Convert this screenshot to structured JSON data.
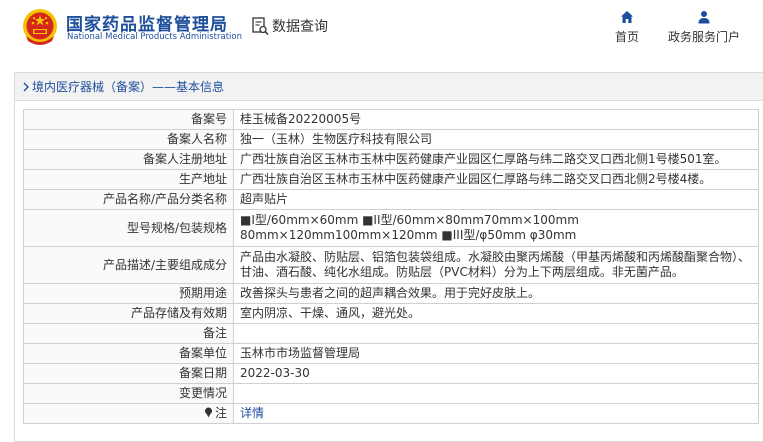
{
  "header": {
    "brand_cn": "国家药品监督管理局",
    "brand_en": "National Medical Products Administration",
    "query_label": "数据查询",
    "nav": [
      {
        "label": "首页",
        "icon": "home-icon"
      },
      {
        "label": "政务服务门户",
        "icon": "user-icon"
      }
    ]
  },
  "breadcrumb": "境内医疗器械（备案）——基本信息",
  "colors": {
    "brand_blue": "#1e4f9c",
    "emblem_red": "#d7261c",
    "emblem_gold": "#f2c300"
  },
  "rows": [
    {
      "label": "备案号",
      "value": "桂玉械备20220005号"
    },
    {
      "label": "备案人名称",
      "value": "独一（玉林）生物医疗科技有限公司"
    },
    {
      "label": "备案人注册地址",
      "value": "广西壮族自治区玉林市玉林中医药健康产业园区仁厚路与纬二路交叉口西北侧1号楼501室。"
    },
    {
      "label": "生产地址",
      "value": "广西壮族自治区玉林市玉林中医药健康产业园区仁厚路与纬二路交叉口西北侧2号楼4楼。"
    },
    {
      "label": "产品名称/产品分类名称",
      "value": "超声贴片"
    },
    {
      "label": "型号规格/包装规格",
      "value": "■I型/60mm×60mm ■II型/60mm×80mm70mm×100mm 80mm×120mm100mm×120mm ■III型/φ50mm φ30mm"
    },
    {
      "label": "产品描述/主要组成成分",
      "value": "产品由水凝胶、防贴层、铝箔包装袋组成。水凝胶由聚丙烯酸（甲基丙烯酸和丙烯酸酯聚合物）、甘油、酒石酸、纯化水组成。防贴层（PVC材料）分为上下两层组成。非无菌产品。"
    },
    {
      "label": "预期用途",
      "value": "改善探头与患者之间的超声耦合效果。用于完好皮肤上。"
    },
    {
      "label": "产品存储及有效期",
      "value": "室内阴凉、干燥、通风，避光处。"
    },
    {
      "label": "备注",
      "value": ""
    },
    {
      "label": "备案单位",
      "value": "玉林市市场监督管理局"
    },
    {
      "label": "备案日期",
      "value": "2022-03-30"
    },
    {
      "label": "变更情况",
      "value": ""
    },
    {
      "label": "注",
      "value": "详情",
      "icon": "note-icon"
    }
  ]
}
